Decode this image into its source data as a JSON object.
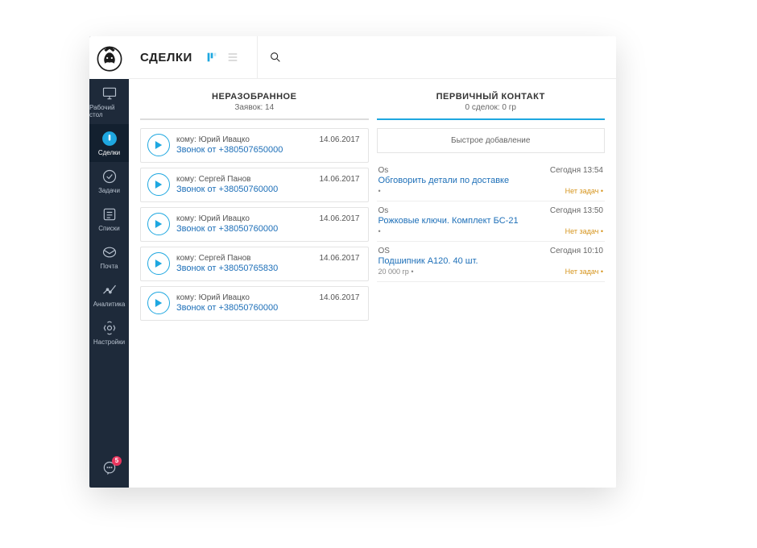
{
  "sidebar": {
    "items": [
      {
        "label": "Рабочий стол"
      },
      {
        "label": "Сделки"
      },
      {
        "label": "Задачи"
      },
      {
        "label": "Списки"
      },
      {
        "label": "Почта"
      },
      {
        "label": "Аналитика"
      },
      {
        "label": "Настройки"
      }
    ],
    "messages_badge": "5"
  },
  "header": {
    "title": "СДЕЛКИ"
  },
  "columns": {
    "unsorted": {
      "title": "НЕРАЗОБРАННОЕ",
      "sub": "Заявок: 14",
      "cards": [
        {
          "to": "кому: Юрий Ивацко",
          "date": "14.06.2017",
          "link": "Звонок от +380507650000"
        },
        {
          "to": "кому: Сергей Панов",
          "date": "14.06.2017",
          "link": "Звонок от +38050760000"
        },
        {
          "to": "кому: Юрий Ивацко",
          "date": "14.06.2017",
          "link": "Звонок от +38050760000"
        },
        {
          "to": "кому: Сергей Панов",
          "date": "14.06.2017",
          "link": "Звонок от +38050765830"
        },
        {
          "to": "кому: Юрий Ивацко",
          "date": "14.06.2017",
          "link": "Звонок от +38050760000"
        }
      ]
    },
    "primary": {
      "title": "ПЕРВИЧНЫЙ КОНТАКТ",
      "sub": "0 сделок: 0 гр",
      "quick_add": "Быстрое добавление",
      "cards": [
        {
          "author": "Os",
          "time": "Сегодня 13:54",
          "title": "Обговорить детали по доставке",
          "amount": "•",
          "no_task": "Нет задач"
        },
        {
          "author": "Os",
          "time": "Сегодня 13:50",
          "title": "Рожковые ключи. Комплект БС-21",
          "amount": "•",
          "no_task": "Нет задач"
        },
        {
          "author": "OS",
          "time": "Сегодня 10:10",
          "title": "Подшипник А120. 40 шт.",
          "amount": "20 000 гр •",
          "no_task": "Нет задач"
        }
      ]
    }
  }
}
